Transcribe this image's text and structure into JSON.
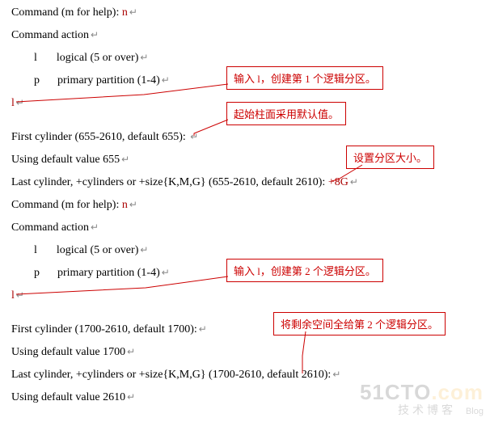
{
  "term": {
    "prompt1": "Command (m for help): ",
    "input_n": "n",
    "cmdaction": "Command action",
    "opt_l": "l",
    "opt_l_txt": "logical (5 or over)",
    "opt_p": "p",
    "opt_p_txt": "primary partition (1-4)",
    "l_input": "l",
    "first_cyl_1": "First cylinder (655-2610, default 655): ",
    "default_655": "Using default value 655",
    "last_cyl_1_pre": "Last cylinder, +cylinders or +size{K,M,G} (655-2610, default 2610): ",
    "plus8g": "+8G",
    "first_cyl_2": "First cylinder (1700-2610, default 1700):",
    "default_1700": "Using default value 1700",
    "last_cyl_2": "Last cylinder, +cylinders or +size{K,M,G} (1700-2610, default 2610):",
    "default_2610": "Using default value 2610",
    "enter": "↵"
  },
  "callouts": {
    "c1": "输入 l，创建第 1 个逻辑分区。",
    "c2": "起始柱面采用默认值。",
    "c3": "设置分区大小。",
    "c4": "输入 l，创建第 2 个逻辑分区。",
    "c5": "将剩余空间全给第 2 个逻辑分区。"
  },
  "watermark": {
    "brand_a": "51CTO",
    "brand_b": ".com",
    "sub": "技术博客",
    "blog": "Blog"
  }
}
